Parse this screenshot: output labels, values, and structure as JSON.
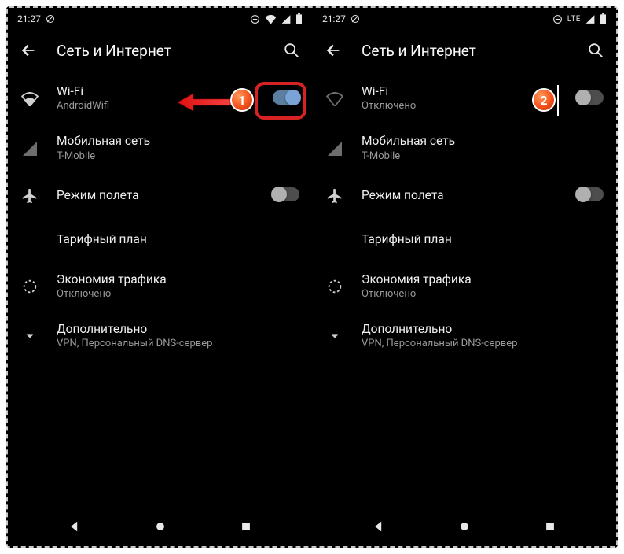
{
  "panels": [
    {
      "status": {
        "time": "21:27",
        "net_label": "",
        "wifi_on": true
      },
      "header": {
        "title": "Сеть и Интернет"
      },
      "rows": {
        "wifi": {
          "title": "Wi-Fi",
          "sub": "AndroidWifi"
        },
        "mobile": {
          "title": "Мобильная сеть",
          "sub": "T-Mobile"
        },
        "airplane": {
          "title": "Режим полета"
        },
        "plan": {
          "title": "Тарифный план"
        },
        "datasaver": {
          "title": "Экономия трафика",
          "sub": "Отключено"
        },
        "more": {
          "title": "Дополнительно",
          "sub": "VPN, Персональный DNS-сервер"
        }
      },
      "marker": "1"
    },
    {
      "status": {
        "time": "21:27",
        "net_label": "LTE",
        "wifi_on": false
      },
      "header": {
        "title": "Сеть и Интернет"
      },
      "rows": {
        "wifi": {
          "title": "Wi-Fi",
          "sub": "Отключено"
        },
        "mobile": {
          "title": "Мобильная сеть",
          "sub": "T-Mobile"
        },
        "airplane": {
          "title": "Режим полета"
        },
        "plan": {
          "title": "Тарифный план"
        },
        "datasaver": {
          "title": "Экономия трафика",
          "sub": "Отключено"
        },
        "more": {
          "title": "Дополнительно",
          "sub": "VPN, Персональный DNS-сервер"
        }
      },
      "marker": "2"
    }
  ]
}
